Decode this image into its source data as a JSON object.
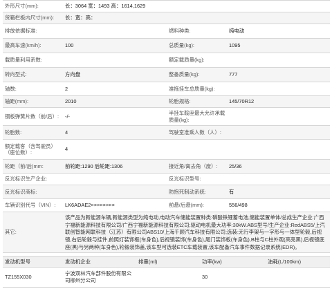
{
  "specs": {
    "dims_label": "外形尺寸(mm):",
    "dims_value": "长：3064 宽：1493 高：1614,1629",
    "cargo_label": "货箱栏板内尺寸(mm):",
    "cargo_value": "长：宽：高：",
    "emission_label": "排放依据标准:",
    "emission_value": "",
    "fuel_type_label": "燃料种类:",
    "fuel_type_value": "纯电动",
    "max_speed_label": "最高车速(km/h):",
    "max_speed_value": "100",
    "total_mass_label": "总质量(kg):",
    "total_mass_value": "1095",
    "load_util_label": "载质量利用系数:",
    "load_util_value": "",
    "rated_load_label": "额定载质量(kg):",
    "rated_load_value": "",
    "steering_label": "转向型式:",
    "steering_value": "方向盘",
    "curb_mass_label": "整备质量(kg):",
    "curb_mass_value": "777",
    "axles_label": "轴数:",
    "axles_value": "2",
    "trailer_mass_label": "准拖挂车总质量(kg):",
    "trailer_mass_value": "",
    "wheelbase_label": "轴距(mm):",
    "wheelbase_value": "2010",
    "tire_label": "轮胎规格:",
    "tire_value": "145/70R12",
    "springs_label": "钢板弹簧片数（前/后）:",
    "springs_value": "-/-",
    "saddle_label": "半挂车鞍座最大允许承载质量(kg):",
    "saddle_value": "",
    "tire_count_label": "轮胎数:",
    "tire_count_value": "4",
    "cab_pass_label": "驾驶室准乘人数（人）:",
    "cab_pass_value": "",
    "passengers_label": "额定载客（含驾驶员）（座位数）:",
    "passengers_value": "4",
    "track_label": "轮距（前/后)mm:",
    "track_value": "前轮距:1290 后轮距:1306",
    "approach_label": "接近角/离去角（度）:",
    "approach_value": "25/36",
    "reflect_label": "反光标识生产企业:",
    "reflect_value": "",
    "reflect_brand_label": "反光标识型号:",
    "reflect_brand_value": "",
    "reflect_model_label": "反光标识商标:",
    "reflect_model_value": "",
    "abs_label": "防抱死制动系统:",
    "abs_value": "有",
    "vin_label": "车辆识别代号（VIN）:",
    "vin_value": "LK6ADAE2××××××××",
    "overhang_label": "前悬/后悬(mm):",
    "overhang_value": "556/498",
    "remarks_label": "其它:",
    "remarks_value": "该产品为新能源车辆,新能源类型为纯电动,电动汽车储能装置种类:磷酸铁锂蓄电池,储能装置单体/总成生产企业:广西宁福新能源科技有限公司/广西宁福新能源科技有限公司;驱动电机最大功率:30kW.ABS型号/生产企业:RedABS5/上汽联创智能网联科技（江苏）有限公司ABS10/上海千顾汽车科技有限公司;选装:无行李架与一字形与一体型轮毂,后视镜,右后轮毂与挂件,前照灯装饰框(车身色),后视镜装饰(车身色),尾门装饰板(车身色),B柱与C柱外观(高亮黑),后视镜底座(黑)与另两种(车身色),轮毂装饰盖,该车型可选装ETC车载装置,该车配备汽车事件数据记录系统(EDR)。"
  },
  "engine_table": {
    "headers": [
      "发动机型号",
      "发动机企业",
      "排量(ml)",
      "功率(kw)",
      "油耗(L/100km)"
    ],
    "rows": [
      [
        "TZ155X030",
        "宁波双林汽车部件股份有限公司柳州分公司",
        "",
        "30",
        ""
      ]
    ]
  }
}
